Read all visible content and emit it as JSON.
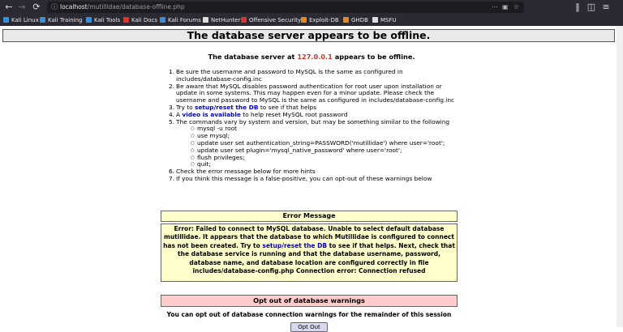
{
  "browser": {
    "url_host": "localhost",
    "url_path": "/mutillidae/database-offline.php",
    "bookmarks": [
      {
        "label": "Kali Linux",
        "color": "#3a8fd9"
      },
      {
        "label": "Kali Training",
        "color": "#3a8fd9"
      },
      {
        "label": "Kali Tools",
        "color": "#3a8fd9"
      },
      {
        "label": "Kali Docs",
        "color": "#d9342b"
      },
      {
        "label": "Kali Forums",
        "color": "#3a8fd9"
      },
      {
        "label": "NetHunter",
        "color": "#dddddd"
      },
      {
        "label": "Offensive Security",
        "color": "#d9342b"
      },
      {
        "label": "Exploit-DB",
        "color": "#e08a1e"
      },
      {
        "label": "GHDB",
        "color": "#e08a1e"
      },
      {
        "label": "MSFU",
        "color": "#dddddd"
      }
    ]
  },
  "page": {
    "title": "The database server appears to be offline.",
    "headline_pre": "The database server at ",
    "headline_ip": "127.0.0.1",
    "headline_post": " appears to be offline.",
    "steps": {
      "s1": "Be sure the username and password to MySQL is the same as configured in includes/database-config.inc",
      "s2": "Be aware that MySQL disables password authentication for root user upon installation or update in some systems. This may happen even for a minor update. Please check the username and password to MySQL is the same as configured in includes/database-config.inc",
      "s3_pre": "Try to ",
      "s3_link": "setup/reset the DB",
      "s3_post": " to see if that helps",
      "s4_pre": "A ",
      "s4_link": "video is available",
      "s4_post": " to help reset MySQL root password",
      "s5": "The commands vary by system and version, but may be something similar to the following",
      "commands": [
        "mysql -u root",
        "use mysql;",
        "update user set authentication_string=PASSWORD('mutillidae') where user='root';",
        "update user set plugin='mysql_native_password' where user='root';",
        "flush privileges;",
        "quit;"
      ],
      "s6": "Check the error message below for more hints",
      "s7": "If you think this message is a false-positive, you can opt-out of these warnings below"
    },
    "error": {
      "heading": "Error Message",
      "text_pre": "Error: Failed to connect to MySQL database. Unable to select default database mutillidae. It appears that the database to which Mutillidae is configured to connect has not been created. Try to ",
      "link": "setup/reset the DB",
      "text_post": " to see if that helps. Next, check that the database service is running and that the database username, password, database name, and database location are configured correctly in file includes/database-config.php Connection error: Connection refused"
    },
    "optout": {
      "heading": "Opt out of database warnings",
      "text": "You can opt out of database connection warnings for the remainder of this session",
      "button": "Opt Out"
    }
  }
}
